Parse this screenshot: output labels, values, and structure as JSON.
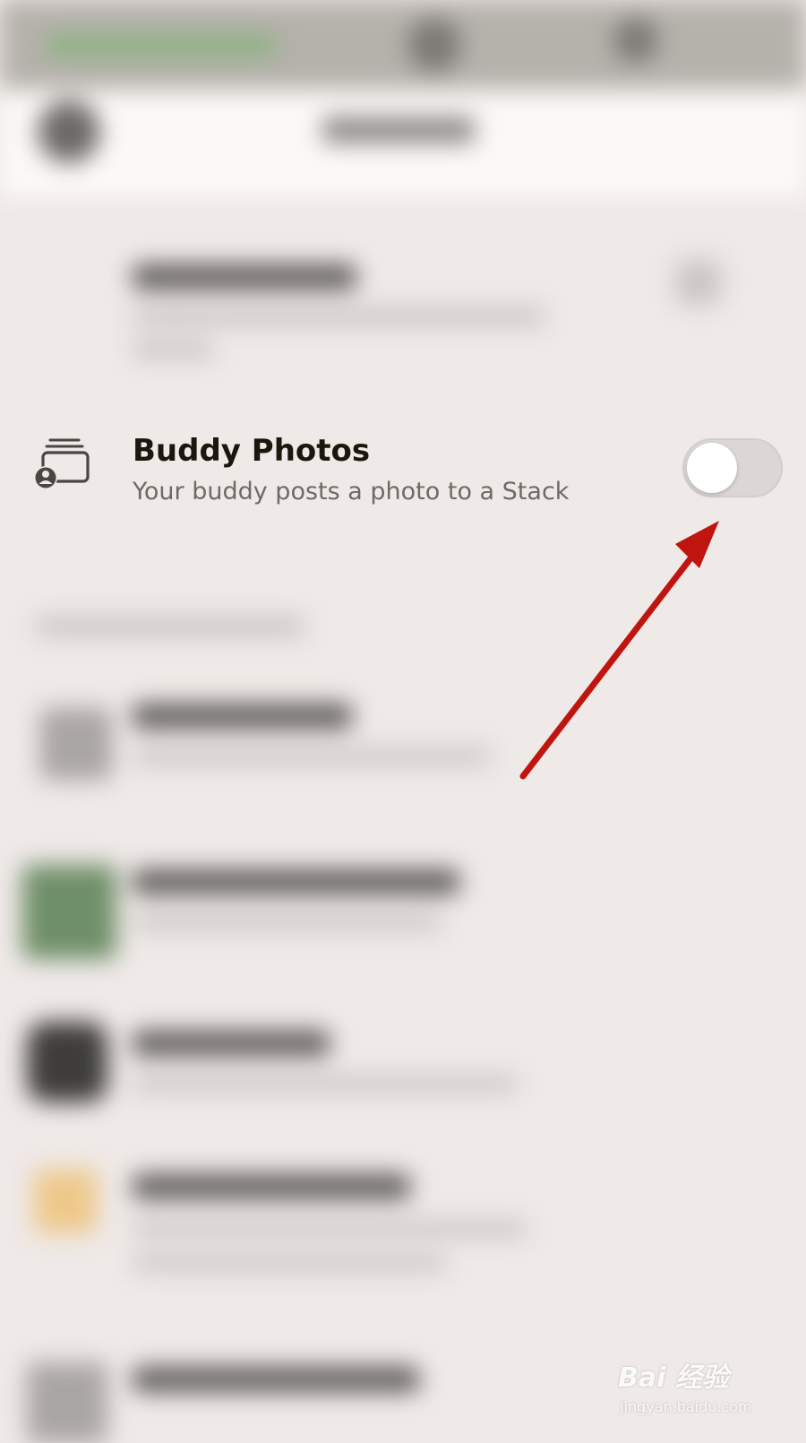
{
  "setting": {
    "title": "Buddy Photos",
    "subtitle": "Your buddy posts a photo to a Stack",
    "toggle_state": "off"
  },
  "icons": {
    "setting_icon": "stack-with-person-icon",
    "annotation": "red-arrow"
  },
  "colors": {
    "annotation_arrow": "#c0150f",
    "toggle_track": "#dcd6d4",
    "toggle_knob": "#ffffff",
    "background": "#efe9e7"
  },
  "watermark": {
    "brand": "Bai 经验",
    "url": "jingyan.baidu.com"
  }
}
